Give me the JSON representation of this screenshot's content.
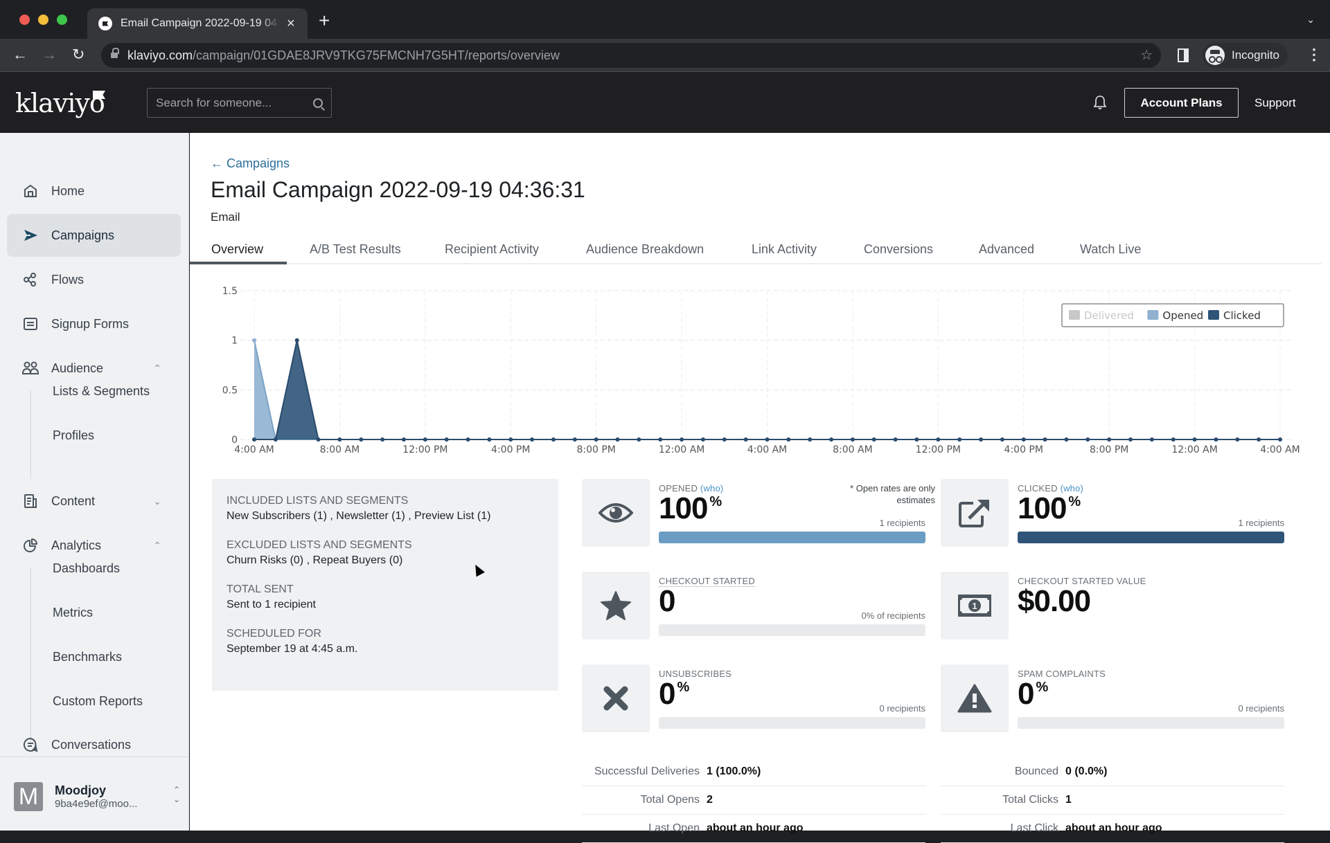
{
  "browser": {
    "tab_title": "Email Campaign 2022-09-19 04:36:31",
    "url_host": "klaviyo.com",
    "url_path": "/campaign/01GDAE8JRV9TKG75FMCNH7G5HT/reports/overview",
    "profile_label": "Incognito"
  },
  "header": {
    "logo": "klaviyo",
    "search_placeholder": "Search for someone...",
    "account_plans_label": "Account Plans",
    "support_label": "Support"
  },
  "sidebar": {
    "items": [
      {
        "label": "Home",
        "icon": "home-icon"
      },
      {
        "label": "Campaigns",
        "icon": "campaigns-icon",
        "active": true
      },
      {
        "label": "Flows",
        "icon": "flows-icon"
      },
      {
        "label": "Signup Forms",
        "icon": "signup-forms-icon"
      },
      {
        "label": "Audience",
        "icon": "audience-icon",
        "expanded": true
      },
      {
        "label": "Content",
        "icon": "content-icon",
        "expanded": false
      },
      {
        "label": "Analytics",
        "icon": "analytics-icon",
        "expanded": true
      },
      {
        "label": "Conversations",
        "icon": "conversations-icon"
      }
    ],
    "audience_sub": [
      "Lists & Segments",
      "Profiles"
    ],
    "analytics_sub": [
      "Dashboards",
      "Metrics",
      "Benchmarks",
      "Custom Reports"
    ],
    "account": {
      "initial": "M",
      "name": "Moodjoy",
      "email": "9ba4e9ef@moo..."
    }
  },
  "page": {
    "breadcrumb": "Campaigns",
    "title": "Email Campaign 2022-09-19 04:36:31",
    "subtitle": "Email",
    "tabs": [
      "Overview",
      "A/B Test Results",
      "Recipient Activity",
      "Audience Breakdown",
      "Link Activity",
      "Conversions",
      "Advanced",
      "Watch Live"
    ],
    "active_tab": "Overview"
  },
  "chart_data": {
    "type": "area",
    "title": "",
    "xlabel": "",
    "ylabel": "",
    "ylim": [
      0,
      1.5
    ],
    "yticks": [
      "0",
      "0.5",
      "1",
      "1.5"
    ],
    "x_interval": "1 hour",
    "x_start": "4:00 AM",
    "x_end": "4:00 AM",
    "x_point_count": 49,
    "xtick_labels": [
      "4:00 AM",
      "8:00 AM",
      "12:00 PM",
      "4:00 PM",
      "8:00 PM",
      "12:00 AM",
      "4:00 AM",
      "8:00 AM",
      "12:00 PM",
      "4:00 PM",
      "8:00 PM",
      "12:00 AM",
      "4:00 AM"
    ],
    "grid": true,
    "legend_position": "top-right",
    "series": [
      {
        "name": "Delivered",
        "color": "#c8c8c8",
        "hidden": true,
        "values": []
      },
      {
        "name": "Opened",
        "color": "#8fb1cf",
        "values": [
          1,
          0,
          0,
          0,
          0,
          0,
          0,
          0,
          0,
          0,
          0,
          0,
          0,
          0,
          0,
          0,
          0,
          0,
          0,
          0,
          0,
          0,
          0,
          0,
          0,
          0,
          0,
          0,
          0,
          0,
          0,
          0,
          0,
          0,
          0,
          0,
          0,
          0,
          0,
          0,
          0,
          0,
          0,
          0,
          0,
          0,
          0,
          0,
          0
        ]
      },
      {
        "name": "Clicked",
        "color": "#2e5478",
        "values": [
          0,
          0,
          1,
          0,
          0,
          0,
          0,
          0,
          0,
          0,
          0,
          0,
          0,
          0,
          0,
          0,
          0,
          0,
          0,
          0,
          0,
          0,
          0,
          0,
          0,
          0,
          0,
          0,
          0,
          0,
          0,
          0,
          0,
          0,
          0,
          0,
          0,
          0,
          0,
          0,
          0,
          0,
          0,
          0,
          0,
          0,
          0,
          0,
          0
        ]
      }
    ]
  },
  "info": {
    "included_label": "INCLUDED LISTS AND SEGMENTS",
    "included_value": "New Subscribers (1) , Newsletter (1) , Preview List (1)",
    "excluded_label": "EXCLUDED LISTS AND SEGMENTS",
    "excluded_value": "Churn Risks (0) , Repeat Buyers (0)",
    "total_sent_label": "TOTAL SENT",
    "total_sent_value": "Sent to 1 recipient",
    "scheduled_label": "SCHEDULED FOR",
    "scheduled_value": "September 19 at 4:45 a.m."
  },
  "metrics": {
    "opened": {
      "label": "OPENED",
      "who": "(who)",
      "value": "100",
      "unit": "%",
      "note": "* Open rates are only estimates",
      "recipients": "1 recipients",
      "fill": 1.0,
      "color": "#6b9dc4"
    },
    "clicked": {
      "label": "CLICKED",
      "who": "(who)",
      "value": "100",
      "unit": "%",
      "recipients": "1 recipients",
      "fill": 1.0,
      "color": "#2f5477"
    },
    "checkout_started": {
      "label": "CHECKOUT STARTED",
      "value": "0",
      "recipients": "0% of recipients",
      "fill": 0
    },
    "checkout_value": {
      "label": "CHECKOUT STARTED VALUE",
      "value": "$0.00"
    },
    "unsubscribes": {
      "label": "UNSUBSCRIBES",
      "value": "0",
      "unit": "%",
      "recipients": "0 recipients",
      "fill": 0
    },
    "spam": {
      "label": "SPAM COMPLAINTS",
      "value": "0",
      "unit": "%",
      "recipients": "0 recipients",
      "fill": 0
    }
  },
  "stats_left": [
    {
      "label": "Successful Deliveries",
      "value": "1 (100.0%)"
    },
    {
      "label": "Total Opens",
      "value": "2"
    },
    {
      "label": "Last Open",
      "value": "about an hour ago"
    }
  ],
  "stats_right": [
    {
      "label": "Bounced",
      "value": "0 (0.0%)"
    },
    {
      "label": "Total Clicks",
      "value": "1"
    },
    {
      "label": "Last Click",
      "value": "about an hour ago"
    }
  ]
}
